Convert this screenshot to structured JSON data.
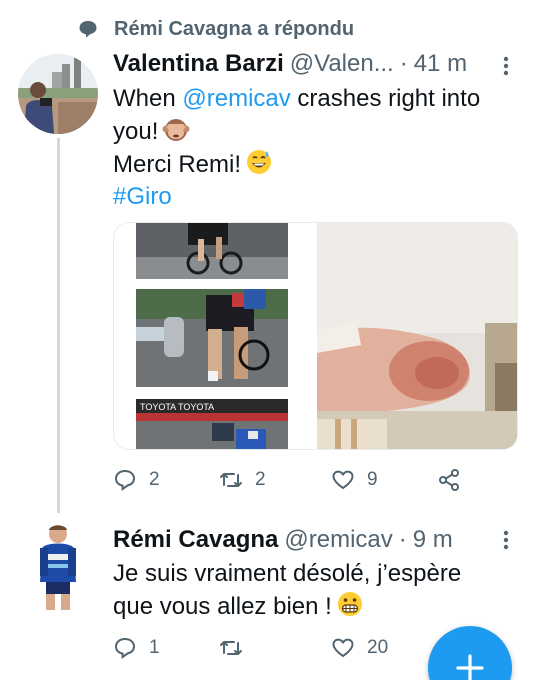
{
  "reply_context": {
    "text": "Rémi Cavagna a répondu",
    "icon": "speech-bubble-icon"
  },
  "tweets": [
    {
      "name": "Valentina Barzi",
      "handle": "@Valen...",
      "separator": "·",
      "time": "41 m",
      "body": {
        "line1_mention": "@remicav",
        "line1_pre": "When ",
        "line1_post": " crashes right into",
        "line2": "you!",
        "line2_emoji": "see-no-evil-monkey",
        "line3": "Merci Remi!",
        "line3_emoji": "grinning-sweat-face",
        "hashtag": "#Giro"
      },
      "media": [
        "race-photo-1",
        "race-photo-2",
        "race-photo-3",
        "bruised-elbow-photo"
      ],
      "actions": {
        "replies": "2",
        "retweets": "2",
        "likes": "9"
      }
    },
    {
      "name": "Rémi Cavagna",
      "handle": "@remicav",
      "separator": "·",
      "time": "9 m",
      "body": {
        "line1": "Je suis vraiment désolé, j’espère",
        "line2": "que vous allez bien !",
        "line2_emoji": "grimacing-face"
      },
      "actions": {
        "replies": "1",
        "retweets": "",
        "likes": "20"
      }
    }
  ],
  "compose_button": {
    "icon": "plus-icon"
  },
  "colors": {
    "accent": "#1d9bf0",
    "secondary_text": "#536471",
    "primary_text": "#0f1419",
    "thread_line": "#cfd9de"
  }
}
